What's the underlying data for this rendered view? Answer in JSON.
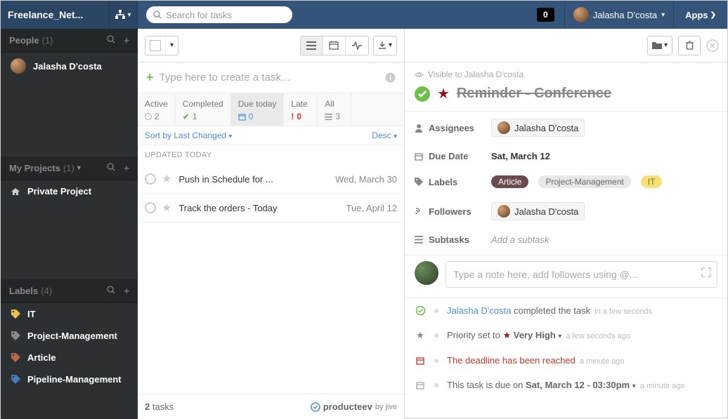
{
  "header": {
    "network": "Freelance_Net...",
    "search_placeholder": "Search for tasks",
    "notif_count": "0",
    "user": "Jalasha D'costa",
    "apps": "Apps"
  },
  "sidebar": {
    "people": {
      "title": "People",
      "count": "(1)"
    },
    "person": "Jalasha D'costa",
    "projects": {
      "title": "My Projects",
      "count": "(1)"
    },
    "project": "Private Project",
    "labels_header": {
      "title": "Labels",
      "count": "(4)"
    },
    "labels": [
      "IT",
      "Project-Management",
      "Article",
      "Pipeline-Management"
    ]
  },
  "mid": {
    "newtask_placeholder": "Type here to create a task...",
    "filters": {
      "active": {
        "label": "Active",
        "val": "2"
      },
      "completed": {
        "label": "Completed",
        "val": "1"
      },
      "due": {
        "label": "Due today",
        "val": "0"
      },
      "late": {
        "label": "Late",
        "val": "0"
      },
      "all": {
        "label": "All",
        "val": "3"
      }
    },
    "sort": "Sort by Last Changed",
    "order": "Desc",
    "group": "UPDATED TODAY",
    "tasks": [
      {
        "title": "Push in Schedule for ...",
        "date": "Wed, March 30"
      },
      {
        "title": "Track the orders - Today",
        "date": "Tue, April 12"
      }
    ],
    "footer_count": "2",
    "footer_label": " tasks",
    "brand": "producteev",
    "brand_suffix": "by jive"
  },
  "detail": {
    "visible": "Visible to Jalasha D'costa",
    "title": "Reminder - Conference",
    "assignees_label": "Assignees",
    "assignee": "Jalasha D'costa",
    "duedate_label": "Due Date",
    "duedate": "Sat, March 12",
    "labels_label": "Labels",
    "tags": {
      "article": "Article",
      "pm": "Project-Management",
      "it": "IT"
    },
    "followers_label": "Followers",
    "follower": "Jalasha D'costa",
    "subtasks_label": "Subtasks",
    "subtasks_add": "Add a subtask",
    "note_placeholder": "Type a note here, add followers using @...",
    "feed": {
      "completed_name": "Jalasha D'costa",
      "completed_rest": " completed the task",
      "completed_time": "in a few seconds",
      "priority_pre": "Priority set to ",
      "priority_val": " Very High",
      "priority_time": "a few seconds ago",
      "deadline": "The deadline has been reached",
      "deadline_time": "a minute ago",
      "due_pre": "This task is due on ",
      "due_bold": "Sat, March 12 - 03:30pm",
      "due_time": "a minute ago"
    }
  }
}
